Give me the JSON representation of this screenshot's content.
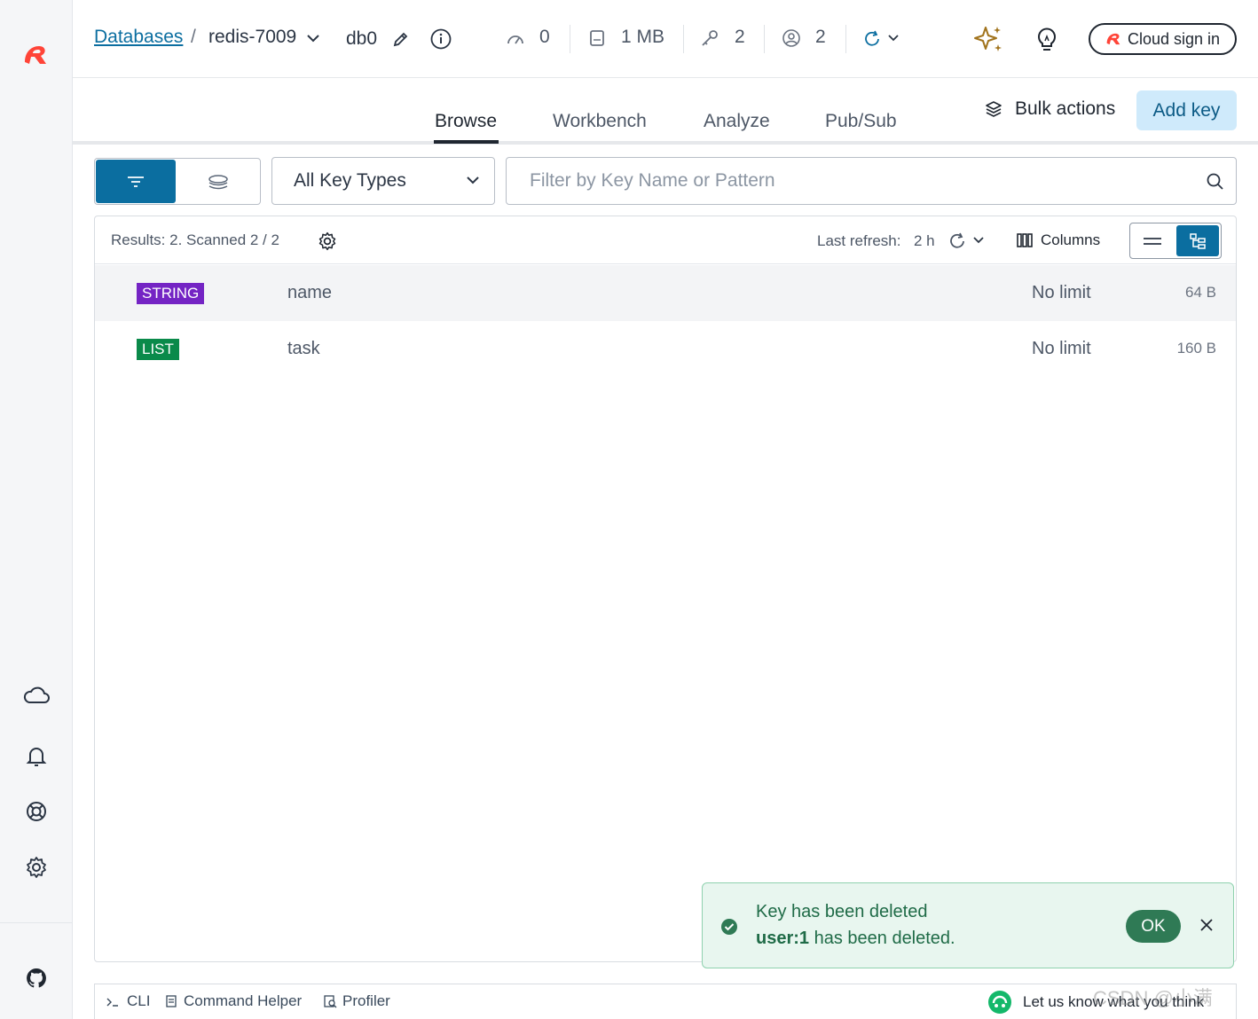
{
  "sidebar": {
    "icons": [
      "redis-logo-icon",
      "cloud-icon",
      "bell-icon",
      "help-lifebuoy-icon",
      "settings-gear-icon",
      "github-icon"
    ]
  },
  "header": {
    "breadcrumb_link": "Databases",
    "breadcrumb_sep": "/",
    "db_name": "redis-7009",
    "db_index": "db0",
    "stats": {
      "ops": "0",
      "memory": "1 MB",
      "keys": "2",
      "clients": "2"
    },
    "cloud_button": "Cloud sign in"
  },
  "tabs": {
    "items": [
      "Browse",
      "Workbench",
      "Analyze",
      "Pub/Sub"
    ],
    "active": "Browse",
    "bulk_actions": "Bulk actions",
    "add_key": "Add key"
  },
  "filter": {
    "key_type": "All Key Types",
    "search_placeholder": "Filter by Key Name or Pattern"
  },
  "results": {
    "summary": "Results: 2. Scanned 2 / 2",
    "last_refresh_label": "Last refresh:",
    "last_refresh_value": "2 h",
    "columns_label": "Columns",
    "rows": [
      {
        "type": "STRING",
        "type_color": "#7424c4",
        "name": "name",
        "ttl": "No limit",
        "size": "64 B"
      },
      {
        "type": "LIST",
        "type_color": "#0a8a4a",
        "name": "task",
        "ttl": "No limit",
        "size": "160 B"
      }
    ]
  },
  "toast": {
    "title": "Key has been deleted",
    "key": "user:1",
    "message": " has been deleted.",
    "ok_label": "OK"
  },
  "bottombar": {
    "cli": "CLI",
    "command_helper": "Command Helper",
    "profiler": "Profiler",
    "feedback": "Let us know what you think"
  },
  "watermark": "CSDN @小满"
}
